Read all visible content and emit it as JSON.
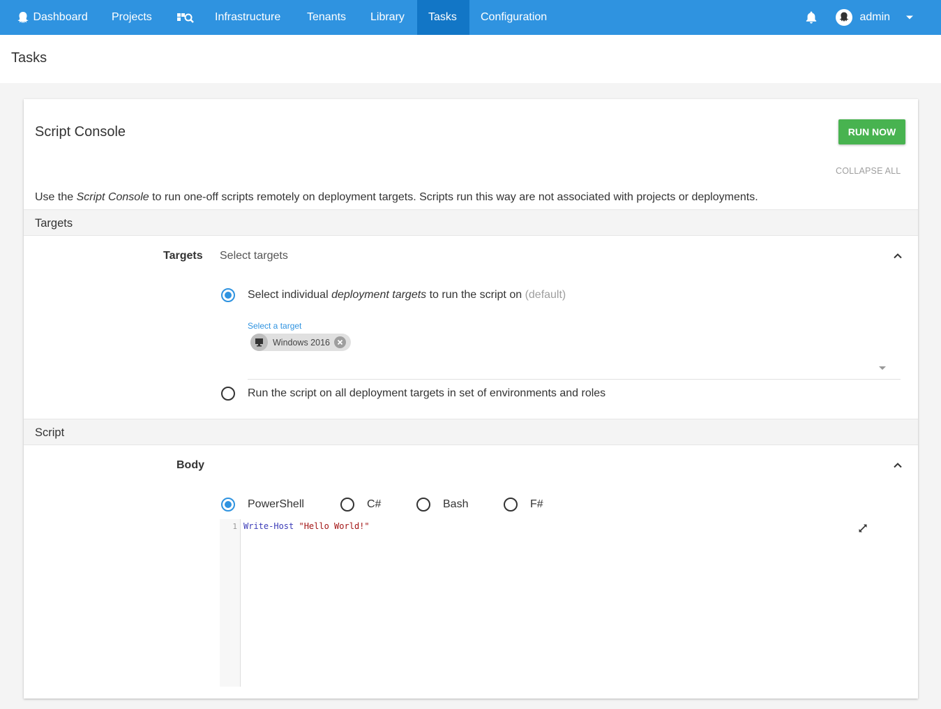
{
  "nav": {
    "dashboard": "Dashboard",
    "projects": "Projects",
    "infrastructure": "Infrastructure",
    "tenants": "Tenants",
    "library": "Library",
    "tasks": "Tasks",
    "configuration": "Configuration",
    "user": "admin"
  },
  "page": {
    "title": "Tasks"
  },
  "card": {
    "title": "Script Console",
    "run_now": "RUN NOW",
    "collapse_all": "COLLAPSE ALL",
    "intro_before": "Use the ",
    "intro_em": "Script Console",
    "intro_after": " to run one-off scripts remotely on deployment targets. Scripts run this way are not associated with projects or deployments."
  },
  "targets_section": {
    "header": "Targets",
    "label": "Targets",
    "summary": "Select targets",
    "option_individual_before": "Select individual ",
    "option_individual_em": "deployment targets",
    "option_individual_after": " to run the script on ",
    "option_individual_default": "(default)",
    "select_label": "Select a target",
    "chip": "Windows 2016",
    "option_all": "Run the script on all deployment targets in set of environments and roles",
    "selected": "individual"
  },
  "script_section": {
    "header": "Script",
    "label": "Body",
    "languages": [
      "PowerShell",
      "C#",
      "Bash",
      "F#"
    ],
    "selected_language": "PowerShell",
    "code_line_number": "1",
    "code_keyword": "Write-Host",
    "code_string": "\"Hello World!\""
  },
  "colors": {
    "nav_bg": "#2f93e0",
    "nav_active": "#1276c6",
    "run_button": "#48b350",
    "accent": "#2f93e0"
  },
  "icons": {
    "logo": "octopus-icon",
    "search": "project-search-icon",
    "notifications": "bell-icon",
    "avatar": "user-avatar-icon",
    "user_menu": "caret-down-icon",
    "collapse": "chevron-up-icon",
    "target": "monitor-icon",
    "remove": "close-circle-icon",
    "expand": "expand-arrows-icon"
  }
}
